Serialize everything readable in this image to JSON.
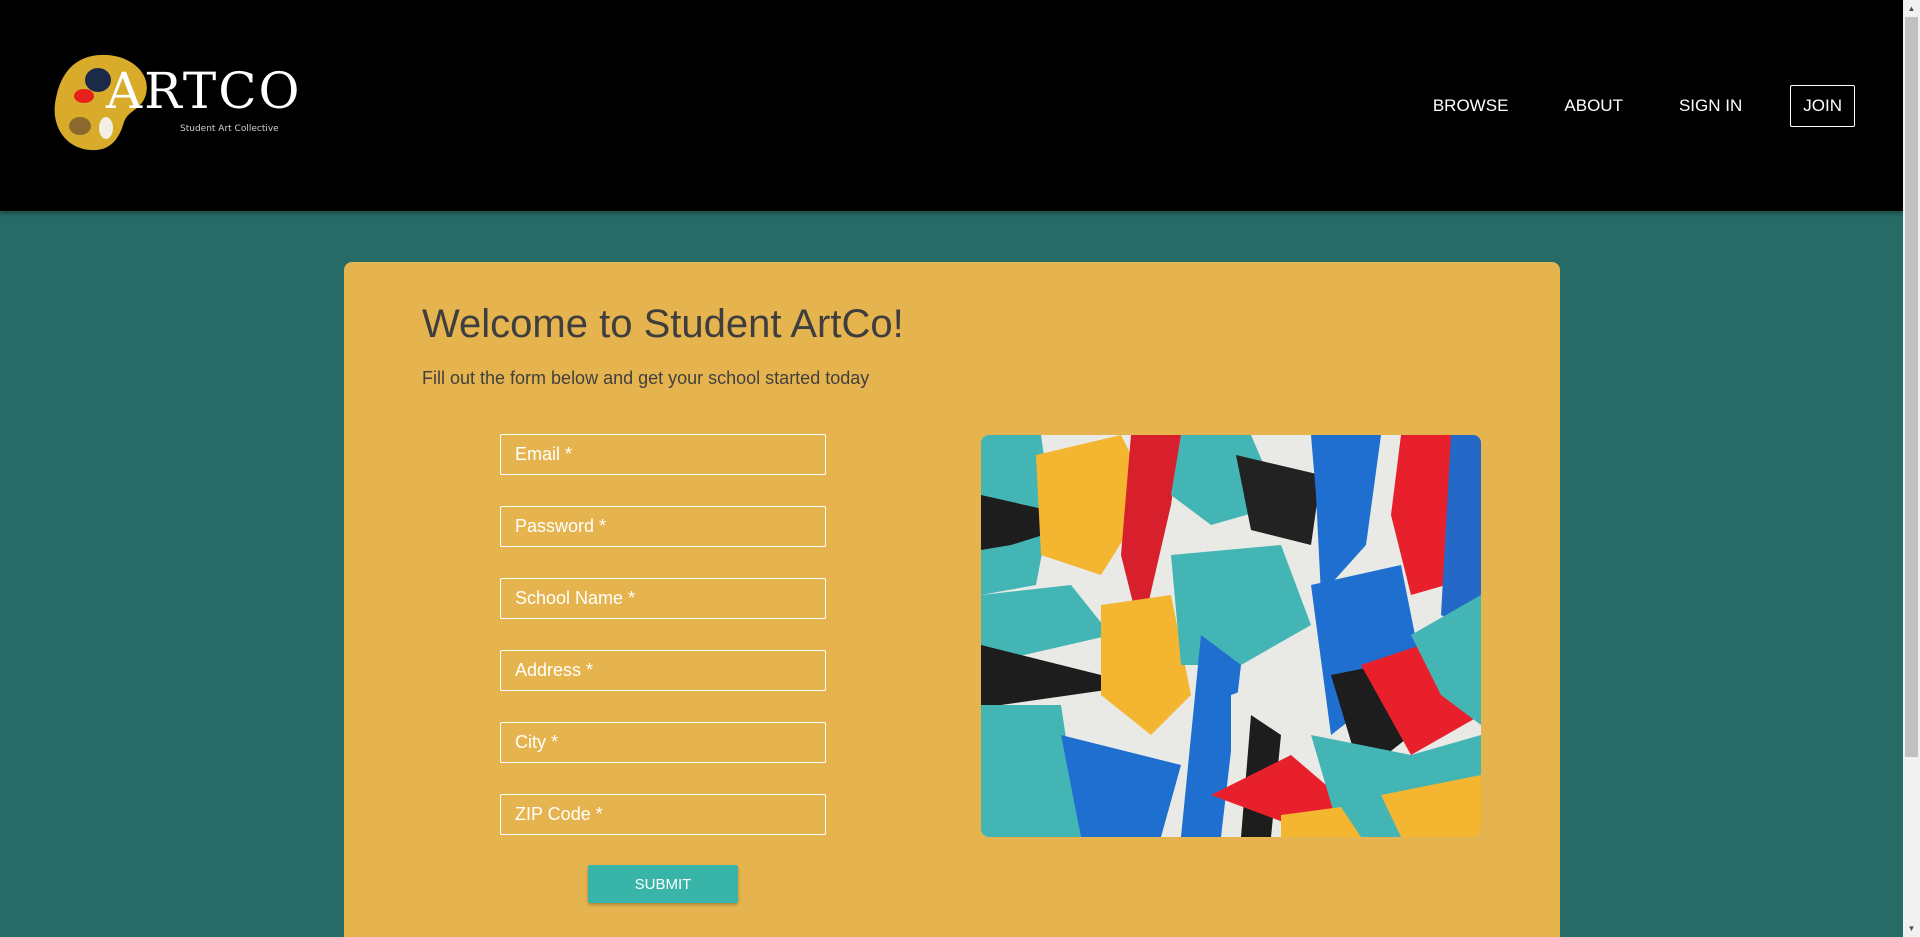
{
  "brand": {
    "name": "ARTCO",
    "tagline": "Student Art Collective"
  },
  "nav": {
    "items": [
      "BROWSE",
      "ABOUT",
      "SIGN IN"
    ],
    "join_label": "JOIN"
  },
  "signup": {
    "title": "Welcome to Student ArtCo!",
    "subtitle": "Fill out the form below and get your school started today",
    "fields": [
      {
        "placeholder": "Email *",
        "value": ""
      },
      {
        "placeholder": "Password *",
        "value": ""
      },
      {
        "placeholder": "School Name *",
        "value": ""
      },
      {
        "placeholder": "Address *",
        "value": ""
      },
      {
        "placeholder": "City *",
        "value": ""
      },
      {
        "placeholder": "ZIP Code *",
        "value": ""
      }
    ],
    "submit_label": "SUBMIT"
  },
  "colors": {
    "page_background": "#266b66",
    "header_background": "#000000",
    "card_background": "#e6b44f",
    "button": "#38b5a8",
    "logo_palette": "#d9ab2b"
  },
  "icons": {
    "scroll_up": "scroll-up-arrow-icon",
    "scroll_down": "scroll-down-arrow-icon"
  }
}
